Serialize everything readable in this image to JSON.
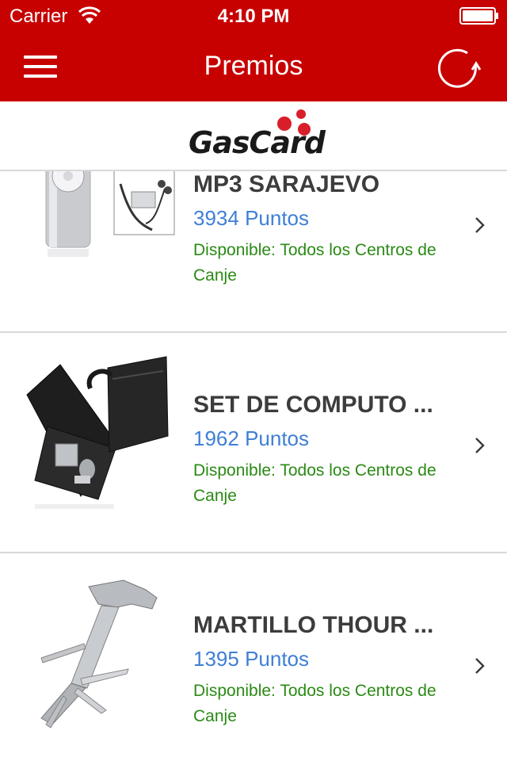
{
  "status": {
    "carrier": "Carrier",
    "time": "4:10 PM"
  },
  "nav": {
    "title": "Premios"
  },
  "brand": {
    "logo_text": "GasCard"
  },
  "items": [
    {
      "name": "MP3 SARAJEVO",
      "points": "3934 Puntos",
      "availability": "Disponible: Todos los Centros de Canje"
    },
    {
      "name": "SET DE COMPUTO ...",
      "points": "1962 Puntos",
      "availability": "Disponible: Todos los Centros de Canje"
    },
    {
      "name": "MARTILLO THOUR ...",
      "points": "1395 Puntos",
      "availability": "Disponible: Todos los Centros de Canje"
    }
  ],
  "colors": {
    "nav_bg": "#c70000",
    "points": "#3f7fd6",
    "availability": "#2a8a14",
    "title_text": "#3c3c3c"
  },
  "icons": {
    "menu": "hamburger-icon",
    "refresh": "refresh-icon",
    "wifi": "wifi-icon",
    "battery": "battery-icon",
    "chevron": "chevron-right-icon"
  }
}
